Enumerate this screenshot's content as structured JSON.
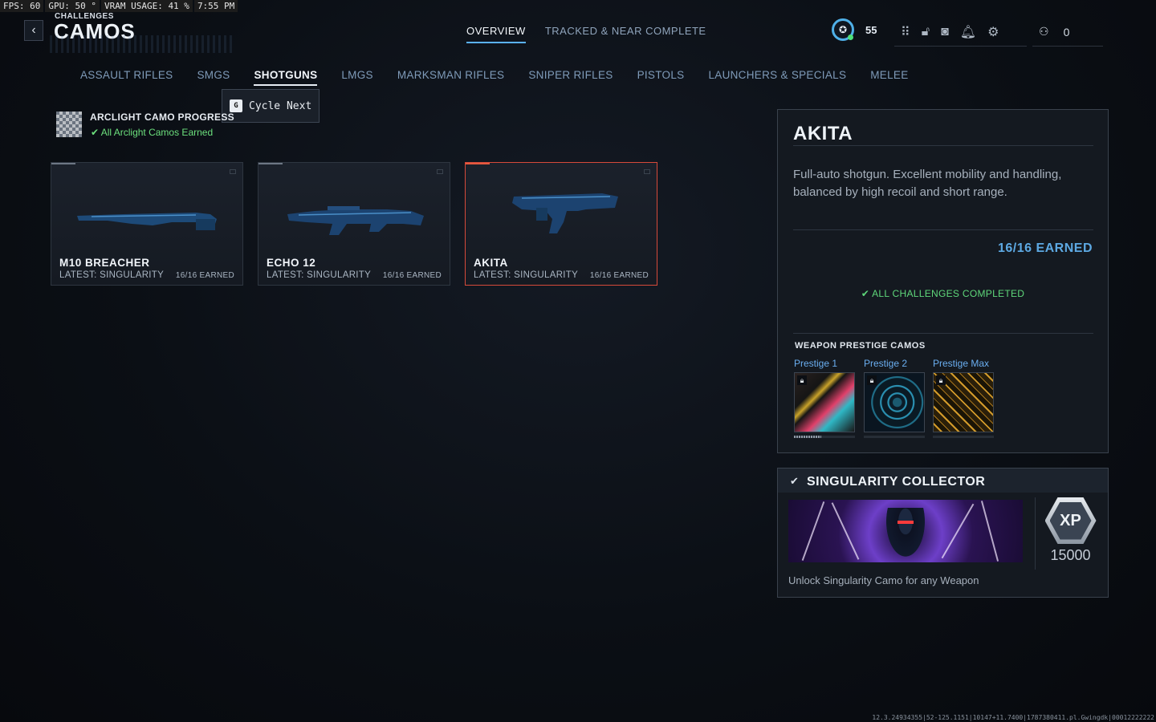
{
  "perf": {
    "fps": "FPS:  60",
    "gpu": "GPU: 50 °",
    "vram": "VRAM USAGE: 41 %",
    "time": "7:55 PM"
  },
  "header": {
    "breadcrumb": "CHALLENGES",
    "title": "CAMOS",
    "back_icon": "‹"
  },
  "top_tabs": [
    {
      "label": "OVERVIEW",
      "active": true
    },
    {
      "label": "TRACKED & NEAR COMPLETE",
      "active": false
    }
  ],
  "hud": {
    "level": "55",
    "party_count": "0"
  },
  "categories": [
    {
      "label": "ASSAULT RIFLES"
    },
    {
      "label": "SMGS"
    },
    {
      "label": "SHOTGUNS",
      "active": true
    },
    {
      "label": "LMGS"
    },
    {
      "label": "MARKSMAN RIFLES"
    },
    {
      "label": "SNIPER RIFLES"
    },
    {
      "label": "PISTOLS"
    },
    {
      "label": "LAUNCHERS & SPECIALS"
    },
    {
      "label": "MELEE"
    }
  ],
  "tooltip": {
    "key": "G",
    "label": "Cycle Next"
  },
  "arclight": {
    "title": "ARCLIGHT CAMO PROGRESS",
    "status": "All Arclight Camos Earned"
  },
  "weapons": [
    {
      "name": "M10 BREACHER",
      "latest": "LATEST: SINGULARITY",
      "earned": "16/16 EARNED"
    },
    {
      "name": "ECHO 12",
      "latest": "LATEST: SINGULARITY",
      "earned": "16/16 EARNED"
    },
    {
      "name": "AKITA",
      "latest": "LATEST: SINGULARITY",
      "earned": "16/16 EARNED",
      "selected": true
    }
  ],
  "detail": {
    "name": "AKITA",
    "description": "Full-auto shotgun. Excellent mobility and handling, balanced by high recoil and short range.",
    "earned": "16/16 EARNED",
    "all_completed": "ALL CHALLENGES COMPLETED",
    "prestige_heading": "WEAPON PRESTIGE CAMOS",
    "prestige": [
      {
        "label": "Prestige 1",
        "progress": 0.45
      },
      {
        "label": "Prestige 2",
        "progress": 0
      },
      {
        "label": "Prestige Max",
        "progress": 0
      }
    ]
  },
  "challenge": {
    "title": "SINGULARITY COLLECTOR",
    "xp_label": "XP",
    "xp_value": "15000",
    "description": "Unlock Singularity Camo for any Weapon"
  },
  "build_string": "12.3.24934355|52-125.1151|10147+11.7400|1787380411.pl.Gwingdk|00012222222",
  "colors": {
    "accent": "#5ab2ff",
    "success": "#5fd77a",
    "selected": "#d64a3a"
  }
}
